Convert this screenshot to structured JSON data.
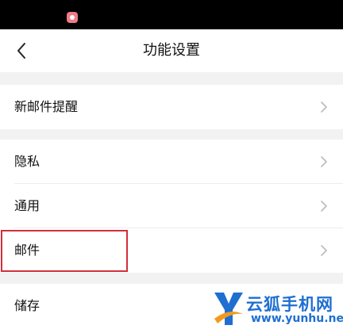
{
  "nav": {
    "title": "功能设置",
    "back_icon": "chevron-left-icon"
  },
  "sections": [
    {
      "items": [
        {
          "label": "新邮件提醒"
        }
      ]
    },
    {
      "items": [
        {
          "label": "隐私"
        },
        {
          "label": "通用"
        },
        {
          "label": "邮件"
        }
      ]
    },
    {
      "items": [
        {
          "label": "储存"
        }
      ]
    }
  ],
  "watermark": {
    "brand": "云狐手机网",
    "url": "www.yunhu.net"
  },
  "colors": {
    "status_bar": "#000000",
    "page_background": "#f2f2f2",
    "row_background": "#ffffff",
    "highlight": "#d22f3b",
    "watermark": "#1e6fd0",
    "chevron": "#bbbbbb"
  }
}
